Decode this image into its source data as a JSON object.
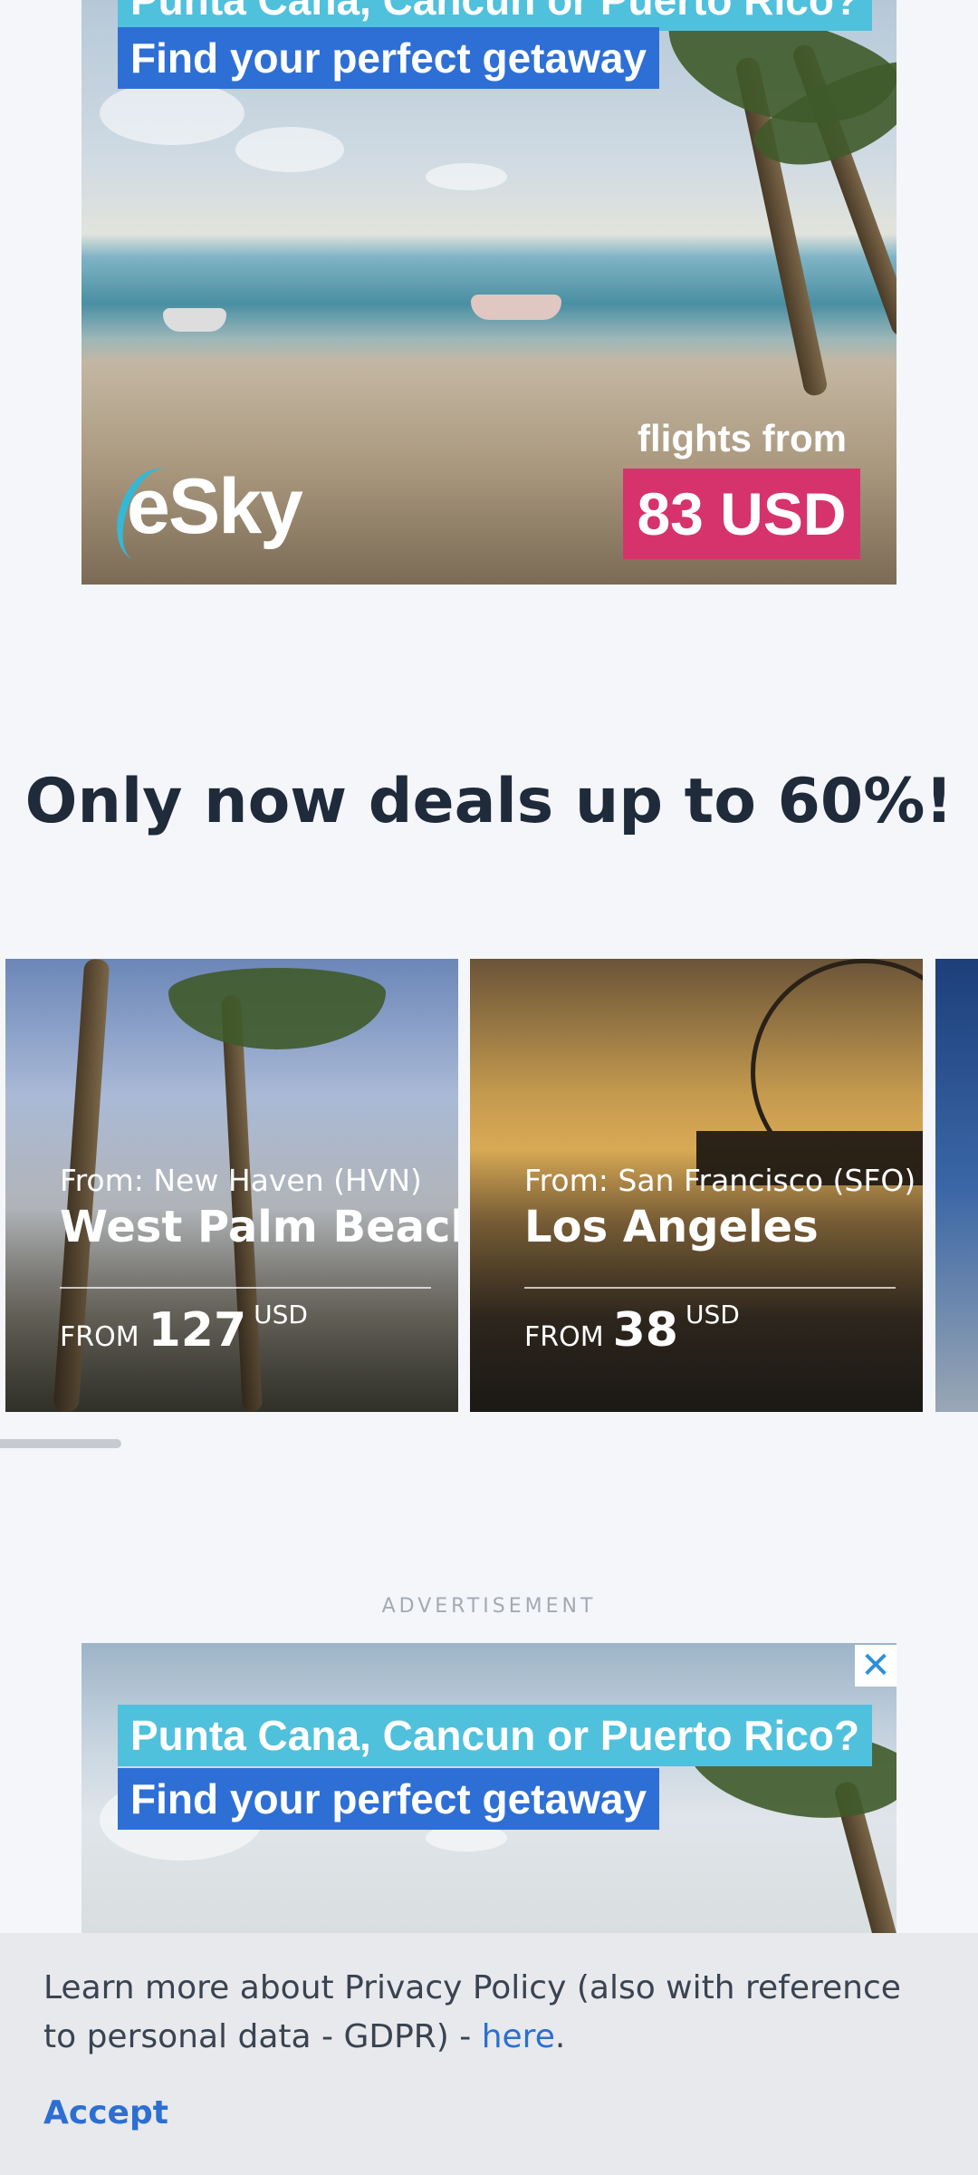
{
  "ad_top": {
    "line1": "Punta Cana, Cancun or Puerto Rico?",
    "line2": "Find your perfect getaway",
    "brand": "eSky",
    "flights_from": "flights from",
    "price": "83 USD"
  },
  "deals": {
    "title": "Only now deals up to 60%!"
  },
  "cards": [
    {
      "from": "From: New Haven (HVN)",
      "destination": "West Palm Beach",
      "price_label": "FROM",
      "price": "127",
      "currency": "USD"
    },
    {
      "from": "From: San Francisco (SFO)",
      "destination": "Los Angeles",
      "price_label": "FROM",
      "price": "38",
      "currency": "USD"
    }
  ],
  "ad_label": "ADVERTISEMENT",
  "ad_bottom": {
    "line1": "Punta Cana, Cancun or Puerto Rico?",
    "line2": "Find your perfect getaway",
    "close": "✕"
  },
  "privacy": {
    "text": "Learn more about Privacy Policy (also with reference to personal data - GDPR) - ",
    "link": "here",
    "period": ".",
    "accept": "Accept"
  },
  "colors": {
    "accent": "#2c6fd1",
    "price_badge": "#d6336c",
    "title": "#1f2a3a"
  }
}
